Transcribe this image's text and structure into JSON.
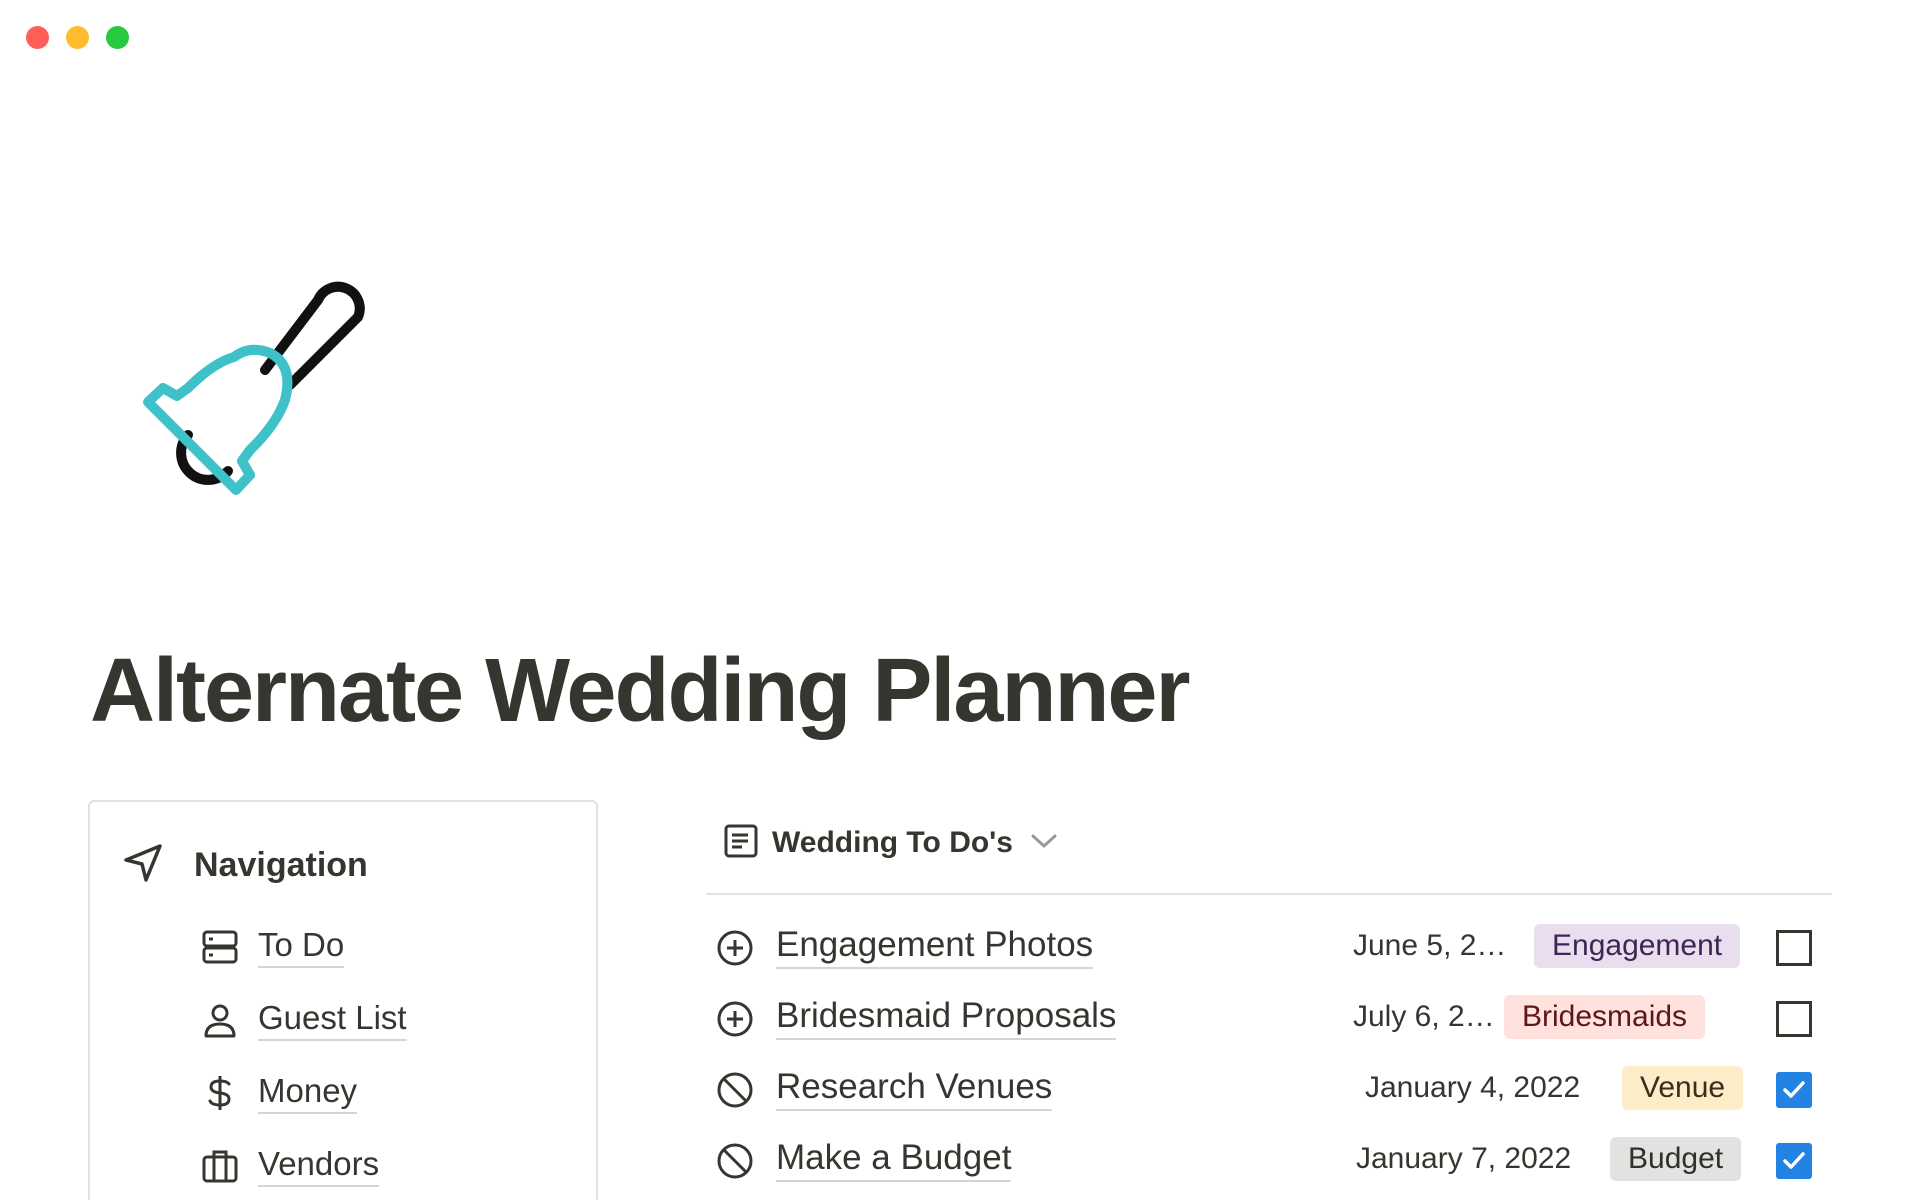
{
  "page": {
    "title": "Alternate Wedding Planner",
    "icon": "bell-icon",
    "icon_colors": {
      "bell": "#3fc1c9",
      "handle": "#111111"
    }
  },
  "navigation": {
    "label": "Navigation",
    "icon": "send-arrow-icon",
    "items": [
      {
        "label": "To Do",
        "icon": "database-icon"
      },
      {
        "label": "Guest List",
        "icon": "person-icon"
      },
      {
        "label": "Money",
        "icon": "dollar-icon"
      },
      {
        "label": "Vendors",
        "icon": "briefcase-icon"
      }
    ]
  },
  "database": {
    "view_name": "Wedding To Do's",
    "view_icon": "list-view-icon",
    "rows": [
      {
        "title": "Engagement Photos",
        "status": "plus-circle-icon",
        "date": "June 5, 2…",
        "tag": "Engagement",
        "tag_bg": "#e8deee",
        "tag_fg": "#412454",
        "checked": false
      },
      {
        "title": "Bridesmaid Proposals",
        "status": "plus-circle-icon",
        "date": "July 6, 2…",
        "tag": "Bridesmaids",
        "tag_bg": "#ffe2dd",
        "tag_fg": "#5d1715",
        "checked": false
      },
      {
        "title": "Research Venues",
        "status": "no-entry-icon",
        "date": "January 4, 2022",
        "tag": "Venue",
        "tag_bg": "#fdecc8",
        "tag_fg": "#402c1b",
        "checked": true
      },
      {
        "title": "Make a Budget",
        "status": "no-entry-icon",
        "date": "January 7, 2022",
        "tag": "Budget",
        "tag_bg": "#e3e2e0",
        "tag_fg": "#32302c",
        "checked": true
      }
    ]
  },
  "colors": {
    "checkbox_checked": "#2383e2",
    "text": "#37352f",
    "divider": "#e3e2e0"
  }
}
